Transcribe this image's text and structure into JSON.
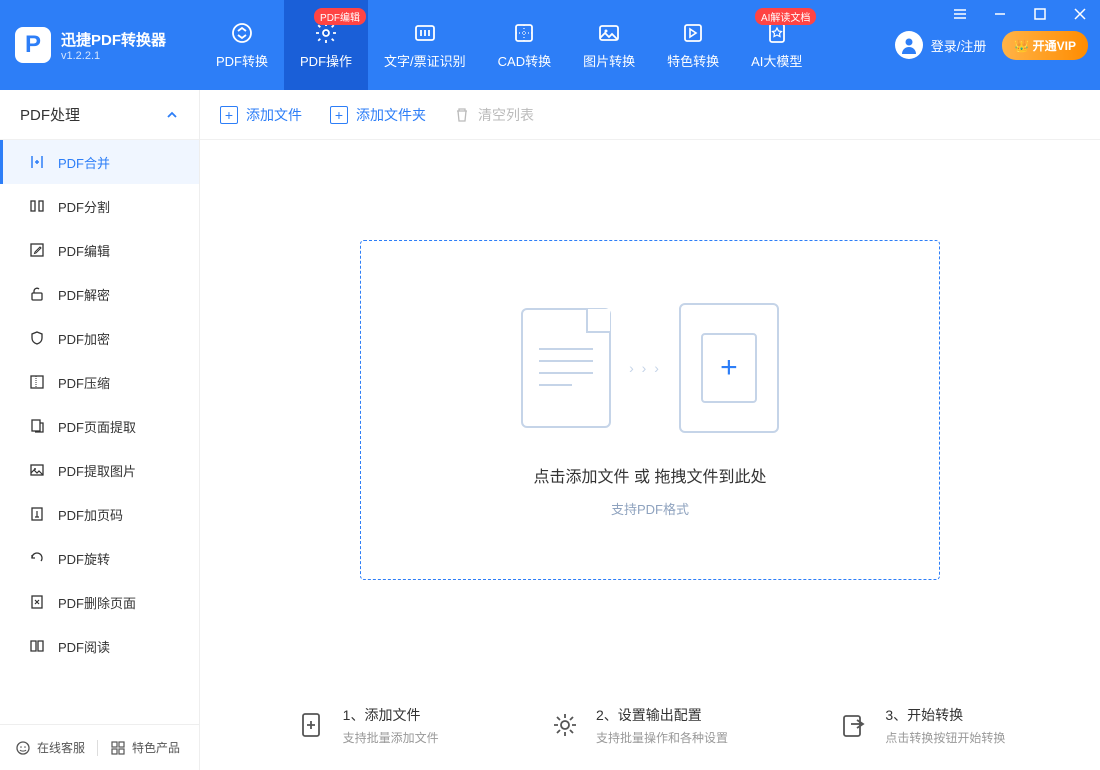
{
  "app": {
    "title": "迅捷PDF转换器",
    "version": "v1.2.2.1"
  },
  "tabs": [
    {
      "label": "PDF转换",
      "badge": null
    },
    {
      "label": "PDF操作",
      "badge": "PDF编辑"
    },
    {
      "label": "文字/票证识别",
      "badge": null
    },
    {
      "label": "CAD转换",
      "badge": null
    },
    {
      "label": "图片转换",
      "badge": null
    },
    {
      "label": "特色转换",
      "badge": null
    },
    {
      "label": "AI大模型",
      "badge": "AI解读文档"
    }
  ],
  "header_right": {
    "login": "登录/注册",
    "vip": "👑 开通VIP"
  },
  "sidebar": {
    "title": "PDF处理",
    "items": [
      "PDF合并",
      "PDF分割",
      "PDF编辑",
      "PDF解密",
      "PDF加密",
      "PDF压缩",
      "PDF页面提取",
      "PDF提取图片",
      "PDF加页码",
      "PDF旋转",
      "PDF删除页面",
      "PDF阅读"
    ],
    "footer": {
      "support": "在线客服",
      "products": "特色产品"
    }
  },
  "toolbar": {
    "add_file": "添加文件",
    "add_folder": "添加文件夹",
    "clear_list": "清空列表"
  },
  "dropzone": {
    "text1": "点击添加文件 或 拖拽文件到此处",
    "text2": "支持PDF格式"
  },
  "steps": [
    {
      "title": "1、添加文件",
      "desc": "支持批量添加文件"
    },
    {
      "title": "2、设置输出配置",
      "desc": "支持批量操作和各种设置"
    },
    {
      "title": "3、开始转换",
      "desc": "点击转换按钮开始转换"
    }
  ]
}
